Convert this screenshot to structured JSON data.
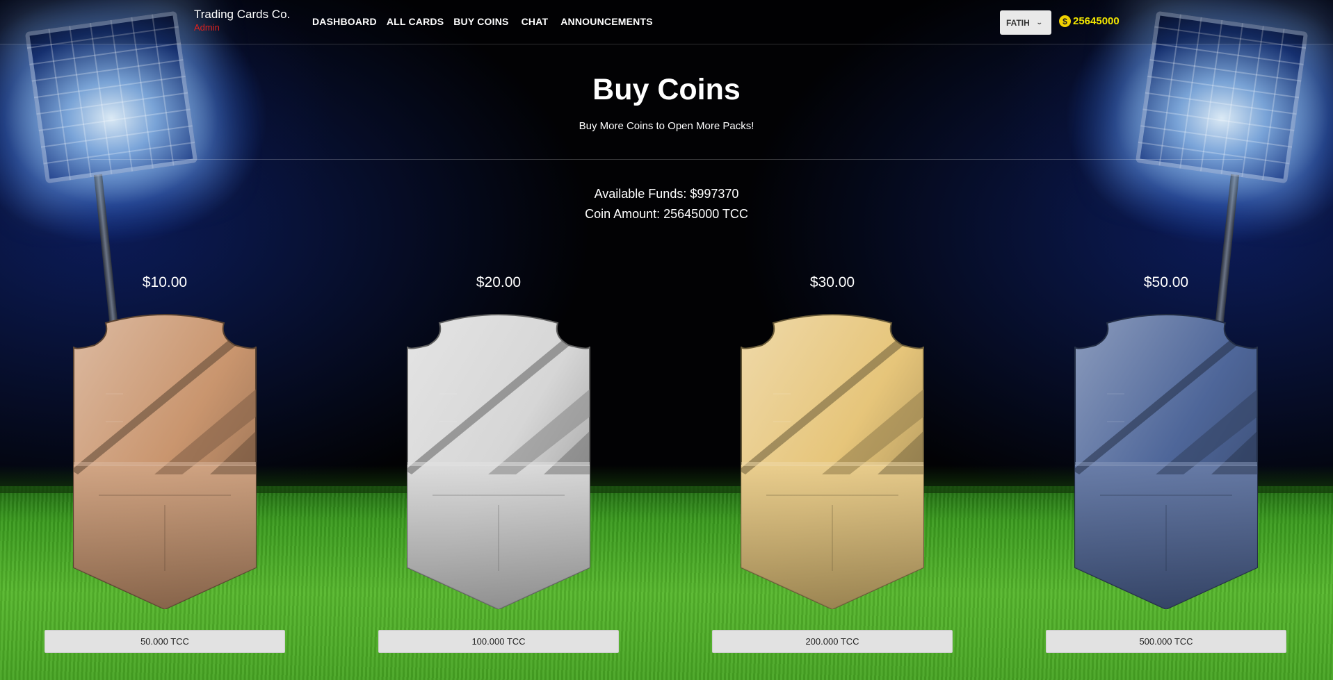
{
  "brand": {
    "name": "Trading Cards Co.",
    "role": "Admin"
  },
  "nav": {
    "links": [
      "DASHBOARD",
      "ALL CARDS",
      "BUY COINS",
      "CHAT",
      "ANNOUNCEMENTS"
    ]
  },
  "user": {
    "name": "FATIH",
    "coins": "25645000"
  },
  "header": {
    "title": "Buy Coins",
    "subtitle": "Buy More Coins to Open More Packs!"
  },
  "account": {
    "funds": "Available Funds: $997370",
    "coin_amount": "Coin Amount: 25645000 TCC"
  },
  "packs": [
    {
      "price": "$10.00",
      "button": "50.000 TCC",
      "tier": "bronze",
      "color": "#c9956e"
    },
    {
      "price": "$20.00",
      "button": "100.000 TCC",
      "tier": "silver",
      "color": "#d6d6d6"
    },
    {
      "price": "$30.00",
      "button": "200.000 TCC",
      "tier": "gold",
      "color": "#e6c57a"
    },
    {
      "price": "$50.00",
      "button": "500.000 TCC",
      "tier": "blue",
      "color": "#4e6699"
    }
  ],
  "colors": {
    "admin": "#e0201c",
    "coins": "#f2e600",
    "accent_coin": "#f2d200"
  }
}
